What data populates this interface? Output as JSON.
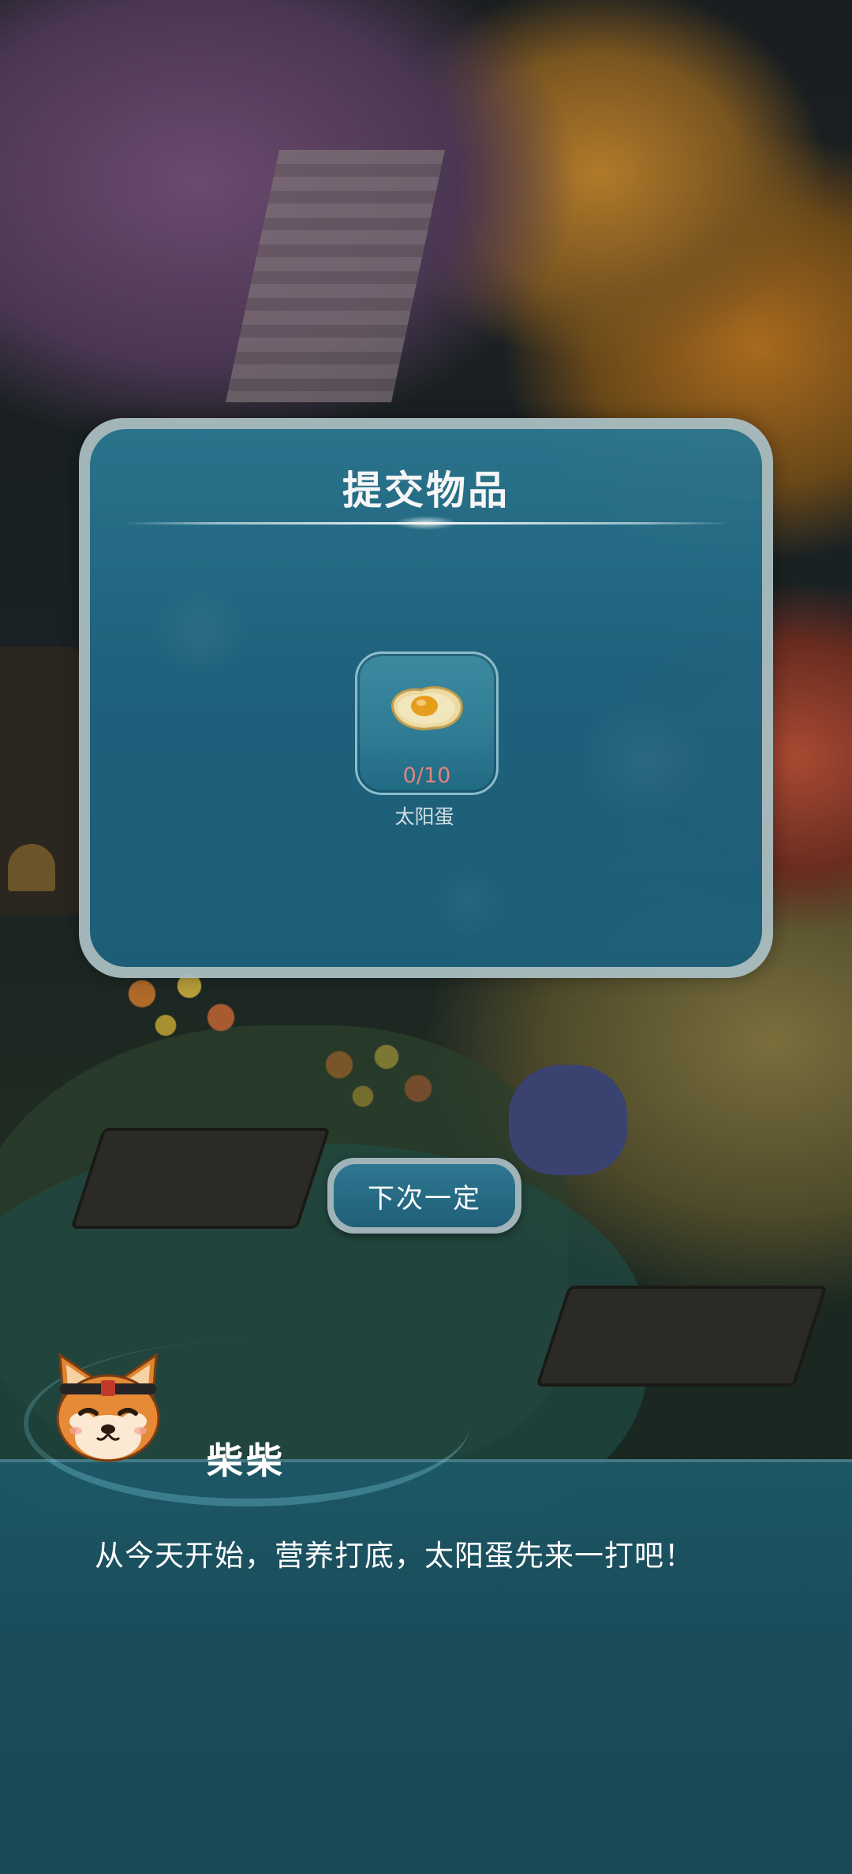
{
  "panel": {
    "title": "提交物品",
    "item": {
      "icon": "sun-egg-icon",
      "count": "0/10",
      "name": "太阳蛋"
    }
  },
  "action_button": {
    "label": "下次一定"
  },
  "dialogue": {
    "speaker": "柴柴",
    "avatar_icon": "shiba-dog-avatar",
    "text": "从今天开始，营养打底，太阳蛋先来一打吧！"
  },
  "colors": {
    "panel_blue": "#1f6480",
    "count_red": "#e98a82",
    "dialogue_teal": "#1d5867"
  }
}
